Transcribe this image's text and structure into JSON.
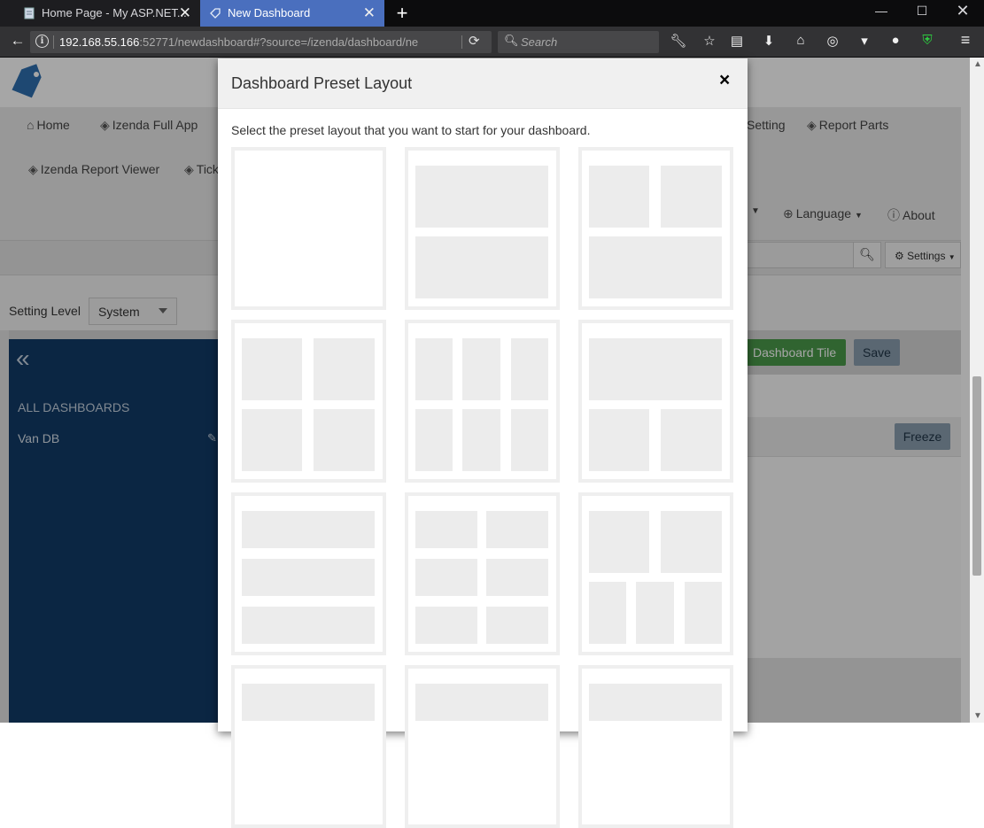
{
  "browser": {
    "tabs": [
      {
        "title": "Home Page - My ASP.NET...",
        "active": false
      },
      {
        "title": "New Dashboard",
        "active": true
      }
    ],
    "url_host": "192.168.55.166",
    "url_rest": ":52771/newdashboard#?source=/izenda/dashboard/ne",
    "search_placeholder": "Search"
  },
  "app": {
    "nav_links": {
      "home": "Home",
      "full_app": "Izenda Full App",
      "setting": "Setting",
      "report_parts": "Report Parts",
      "report_viewer": "Izenda Report Viewer",
      "tick": "Tick",
      "language": "Language",
      "about": "About"
    },
    "settings_button": "Settings",
    "setting_level_label": "Setting Level",
    "setting_level_value": "System",
    "sidebar": {
      "heading": "ALL DASHBOARDS",
      "items": [
        "Van DB"
      ]
    },
    "toolbar": {
      "add_tile": "Dashboard Tile",
      "save": "Save",
      "freeze": "Freeze"
    }
  },
  "modal": {
    "title": "Dashboard Preset Layout",
    "close": "×",
    "instruction": "Select the preset layout that you want to start for your dashboard.",
    "preset_names": [
      "layout-1-full",
      "layout-2-rows",
      "layout-2-top-1-bottom",
      "layout-2x2",
      "layout-3x2",
      "layout-1-top-2-bottom",
      "layout-3-rows",
      "layout-2x3",
      "layout-2-top-3-bottom",
      "layout-row-4a",
      "layout-row-4b",
      "layout-row-4c"
    ]
  },
  "colors": {
    "sidebar_bg": "#123b67",
    "add_tile_bg": "#4a9a4a",
    "accent_tab": "#4a6fbe"
  }
}
